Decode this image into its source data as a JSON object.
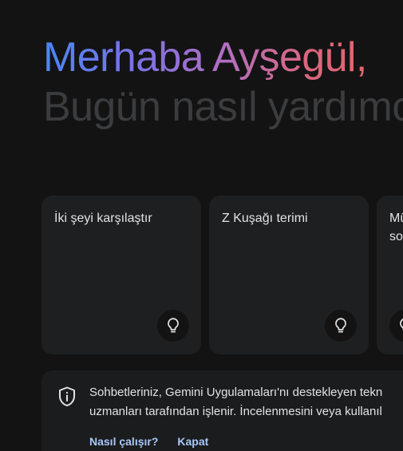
{
  "greeting": {
    "line1": "Merhaba Ayşegül,",
    "line2": "Bugün nasıl yardımcı olabilirim?"
  },
  "suggestions": [
    {
      "text": "İki şeyi karşılaştır",
      "icon": "lightbulb-icon"
    },
    {
      "text": "Z Kuşağı terimi",
      "icon": "lightbulb-icon"
    },
    {
      "text": "Mü so",
      "icon": "lightbulb-icon"
    }
  ],
  "notice": {
    "line1": "Sohbetleriniz, Gemini Uygulamaları'nı destekleyen tekn",
    "line2": "uzmanları tarafından işlenir. İncelenmesini veya kullanıl",
    "links": {
      "how_it_works": "Nasıl çalışır?",
      "close": "Kapat"
    },
    "icon": "shield-info-icon"
  },
  "colors": {
    "background": "#131314",
    "card": "#1e1f20",
    "link": "#a8c7fa",
    "gradient_start": "#4b86f5",
    "gradient_end": "#e4666b"
  }
}
